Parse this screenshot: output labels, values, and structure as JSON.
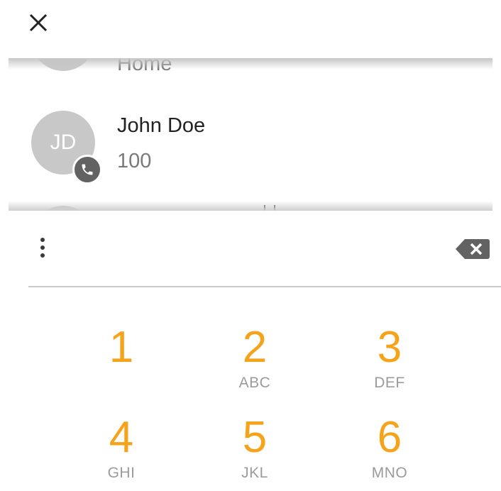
{
  "header": {
    "close_icon": "close-icon"
  },
  "contacts": {
    "previous": {
      "number": "Home"
    },
    "current": {
      "initials": "JD",
      "name": "John Doe",
      "number": "100",
      "badge_icon": "phone-icon"
    }
  },
  "input_bar": {
    "more_icon": "more-vert-icon",
    "backspace_icon": "backspace-icon"
  },
  "keypad": {
    "keys": [
      {
        "digit": "1",
        "letters": ""
      },
      {
        "digit": "2",
        "letters": "ABC"
      },
      {
        "digit": "3",
        "letters": "DEF"
      },
      {
        "digit": "4",
        "letters": "GHI"
      },
      {
        "digit": "5",
        "letters": "JKL"
      },
      {
        "digit": "6",
        "letters": "MNO"
      }
    ]
  },
  "colors": {
    "accent": "#f5a31a",
    "avatar": "#c8c8c8",
    "badge": "#626262",
    "secondary_text": "#7a7a7a",
    "divider": "#c9c9c9"
  }
}
